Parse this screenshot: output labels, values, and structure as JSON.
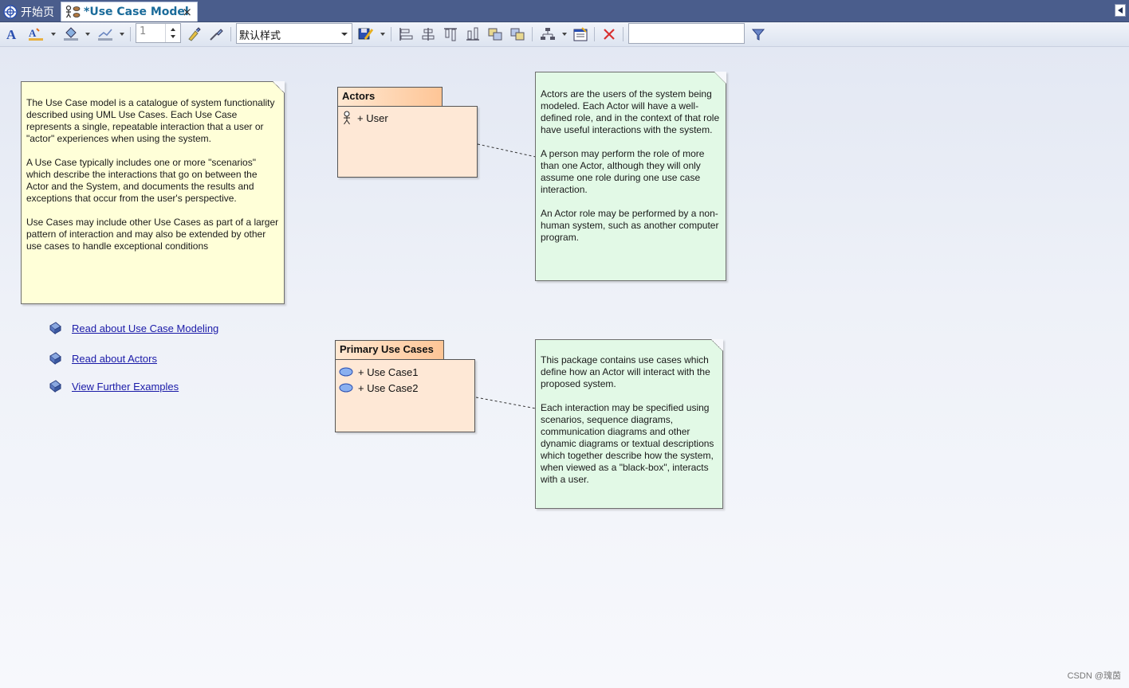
{
  "tabs": {
    "home_label": "开始页",
    "active_label": "*Use Case Model",
    "close_glyph": "×"
  },
  "toolbar": {
    "line_width_value": "1",
    "style_select_value": "默认样式",
    "filter_value": ""
  },
  "notes": {
    "intro": [
      "The Use Case model is a catalogue of system functionality described using UML Use Cases. Each Use Case represents a single, repeatable interaction that a user or \"actor\" experiences when using the system.",
      "A Use Case typically includes one or more \"scenarios\" which describe the interactions that go on between the Actor and the System, and documents the results and exceptions that occur from the user's perspective.",
      "Use Cases may include other Use Cases as part of a larger pattern of interaction and may also be extended by other use cases to handle exceptional conditions"
    ],
    "actors": [
      "Actors are the users of the system being modeled. Each Actor will have a well-defined role, and in the context of that role have useful interactions with the system.",
      "A person may perform the role of more than one Actor, although they will only assume one role during one use case interaction.",
      "An Actor role may be performed by a non-human system, such as another computer program."
    ],
    "use_cases": [
      "This package contains use cases which define how an Actor will interact with the proposed system.",
      "Each interaction may be specified using scenarios, sequence diagrams, communication diagrams and other dynamic diagrams or textual descriptions which together describe how the system, when viewed as a \"black-box\", interacts with a user."
    ]
  },
  "packages": {
    "actors": {
      "title": "Actors",
      "items": [
        "+ User"
      ]
    },
    "use_cases": {
      "title": "Primary Use Cases",
      "items": [
        "+ Use Case1",
        "+ Use Case2"
      ]
    }
  },
  "links": [
    "Read about Use Case Modeling ",
    "Read about Actors",
    "View Further Examples"
  ],
  "watermark": "CSDN @瑰茵",
  "colors": {
    "tabbar": "#4a5d8c",
    "note_yellow": "#ffffd8",
    "note_green": "#e2f9e6",
    "package_fill": "#fee8d6",
    "link": "#1a1aa8"
  }
}
